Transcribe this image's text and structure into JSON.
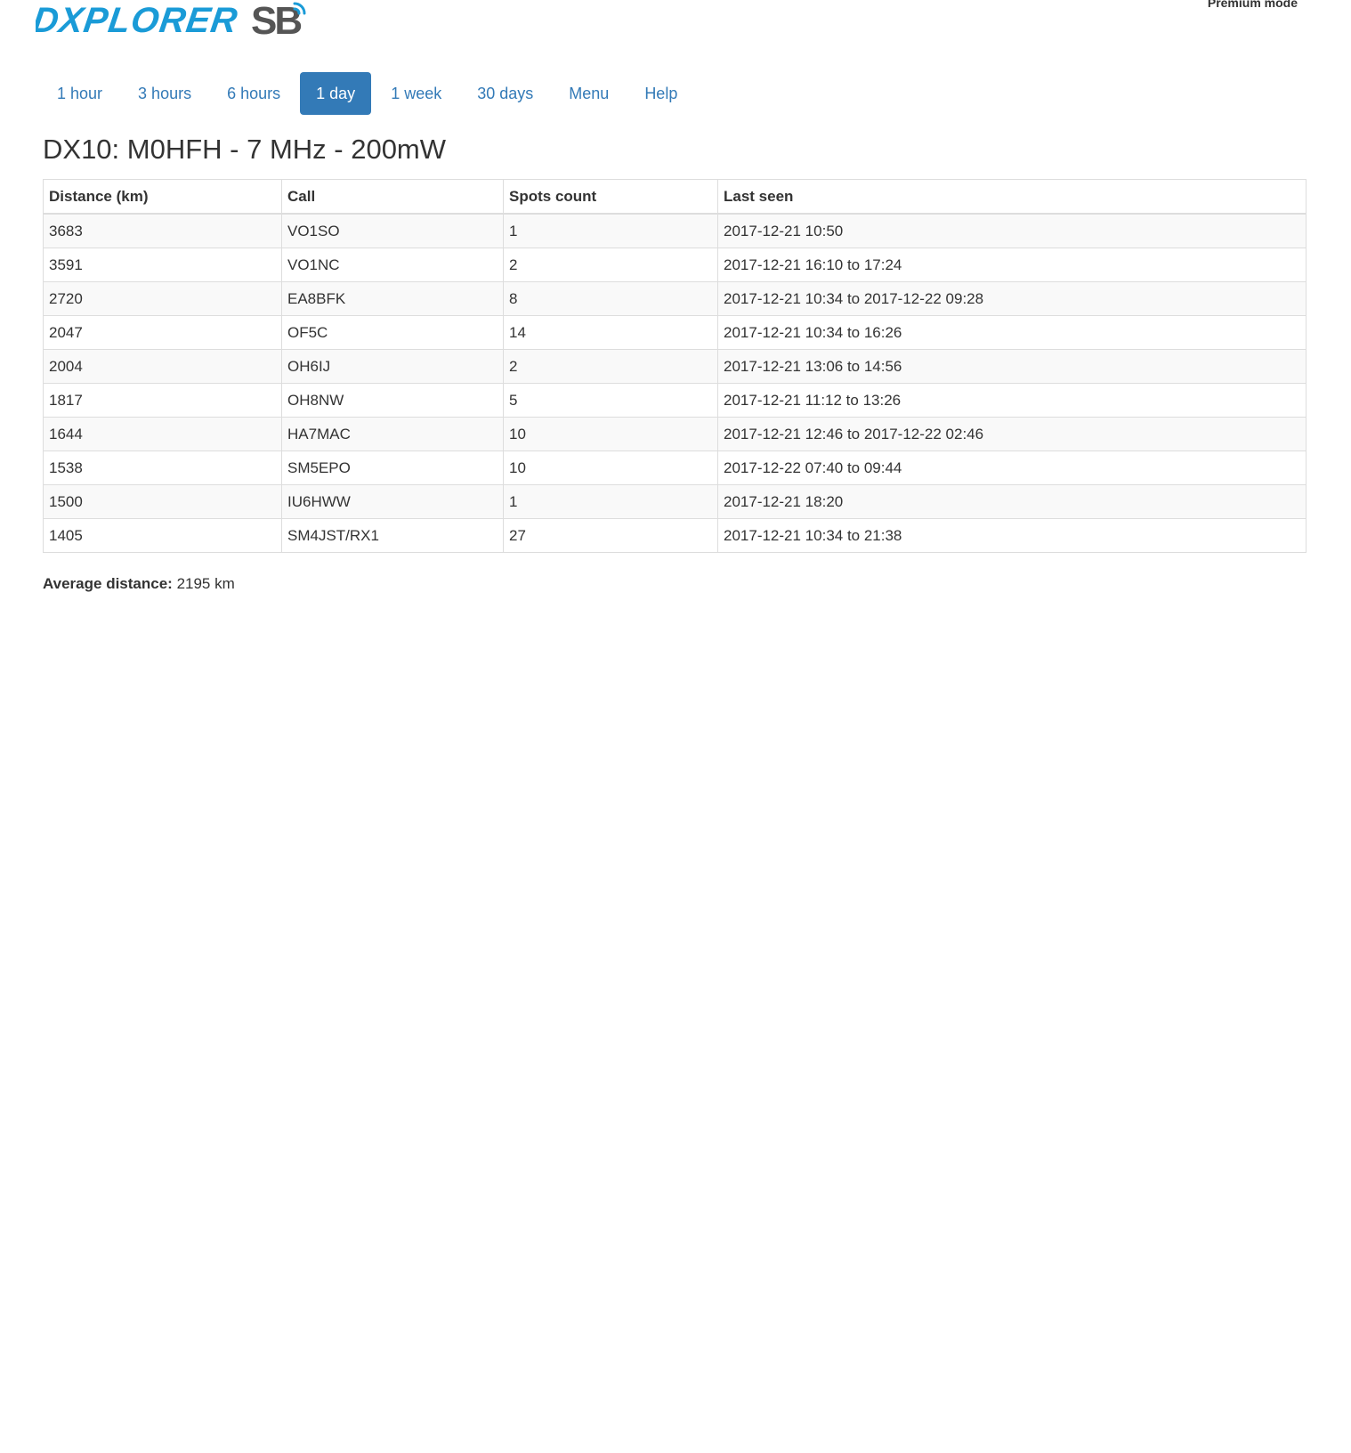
{
  "header": {
    "logo_text": "DXPLORER",
    "logo_badge": "SB",
    "logo_badge_icon": "wifi-signal-icon",
    "premium_label": "Premium mode"
  },
  "nav": {
    "tabs": [
      {
        "label": "1 hour",
        "active": false
      },
      {
        "label": "3 hours",
        "active": false
      },
      {
        "label": "6 hours",
        "active": false
      },
      {
        "label": "1 day",
        "active": true
      },
      {
        "label": "1 week",
        "active": false
      },
      {
        "label": "30 days",
        "active": false
      },
      {
        "label": "Menu",
        "active": false
      },
      {
        "label": "Help",
        "active": false
      }
    ]
  },
  "main": {
    "title": "DX10: M0HFH - 7 MHz - 200mW",
    "table": {
      "headers": [
        "Distance (km)",
        "Call",
        "Spots count",
        "Last seen"
      ],
      "rows": [
        [
          "3683",
          "VO1SO",
          "1",
          "2017-12-21 10:50"
        ],
        [
          "3591",
          "VO1NC",
          "2",
          "2017-12-21 16:10 to 17:24"
        ],
        [
          "2720",
          "EA8BFK",
          "8",
          "2017-12-21 10:34 to 2017-12-22 09:28"
        ],
        [
          "2047",
          "OF5C",
          "14",
          "2017-12-21 10:34 to 16:26"
        ],
        [
          "2004",
          "OH6IJ",
          "2",
          "2017-12-21 13:06 to 14:56"
        ],
        [
          "1817",
          "OH8NW",
          "5",
          "2017-12-21 11:12 to 13:26"
        ],
        [
          "1644",
          "HA7MAC",
          "10",
          "2017-12-21 12:46 to 2017-12-22 02:46"
        ],
        [
          "1538",
          "SM5EPO",
          "10",
          "2017-12-22 07:40 to 09:44"
        ],
        [
          "1500",
          "IU6HWW",
          "1",
          "2017-12-21 18:20"
        ],
        [
          "1405",
          "SM4JST/RX1",
          "27",
          "2017-12-21 10:34 to 21:38"
        ]
      ]
    },
    "average": {
      "label": "Average distance:",
      "value": "2195 km"
    }
  },
  "colors": {
    "logo_blue": "#1a9bd7",
    "logo_gray": "#555555",
    "link": "#337ab7",
    "active_tab_bg": "#337ab7"
  }
}
